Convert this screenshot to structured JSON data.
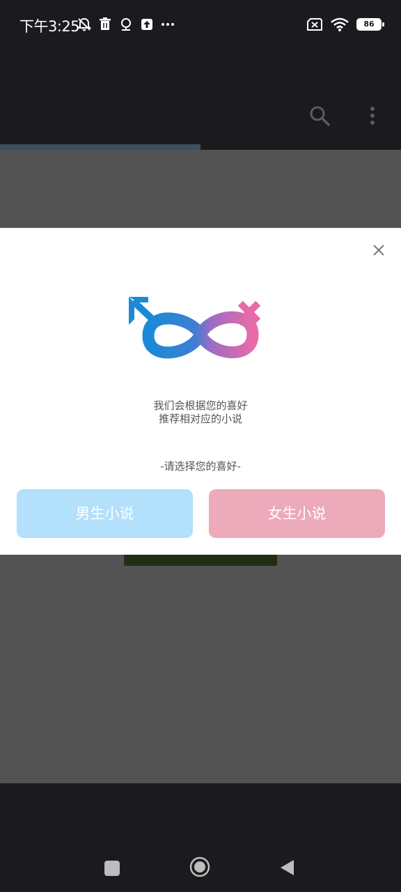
{
  "status_bar": {
    "time": "下午3:25",
    "battery": "86",
    "left_icons": [
      "mute-icon",
      "trash-icon",
      "location-icon",
      "upload-icon",
      "more-dots-icon"
    ],
    "right_icons": [
      "sim-off-icon",
      "wifi-icon",
      "battery-icon"
    ]
  },
  "app_bar": {
    "icons": [
      "search-icon",
      "more-vertical-icon"
    ]
  },
  "progress": {
    "fraction": 0.5
  },
  "dialog": {
    "description_line1": "我们会根据您的喜好",
    "description_line2": "推荐相对应的小说",
    "prompt": "-请选择您的喜好-",
    "male_button": "男生小说",
    "female_button": "女生小说",
    "colors": {
      "male": "#b3e0fb",
      "female": "#ecaabb",
      "male_icon": "#1a8ad6",
      "female_icon": "#e86ba8"
    }
  },
  "nav_bar": {
    "icons": [
      "recent-apps-icon",
      "home-icon",
      "back-icon"
    ]
  }
}
